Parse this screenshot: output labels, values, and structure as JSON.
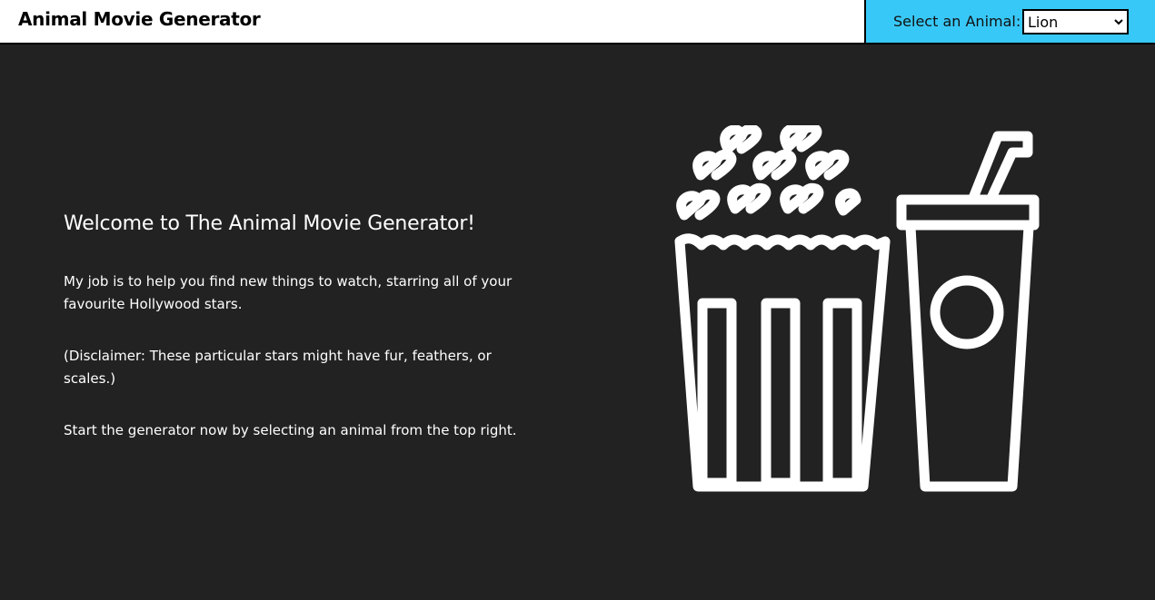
{
  "header": {
    "title": "Animal Movie Generator"
  },
  "animal_picker": {
    "label": "Select an Animal:",
    "selected": "Lion"
  },
  "intro": {
    "heading": "Welcome to The Animal Movie Generator!",
    "paragraphs": [
      "My job is to help you find new things to watch, starring all of your favourite Hollywood stars.",
      "(Disclaimer: These particular stars might have fur, feathers, or scales.)",
      "Start the generator now by selecting an animal from the top right."
    ]
  },
  "illustration": {
    "icons": [
      "popcorn-bucket-icon",
      "soda-cup-icon"
    ]
  },
  "colors": {
    "background": "#222222",
    "topbar": "#ffffff",
    "accent": "#38c8f7",
    "text": "#ffffff"
  }
}
